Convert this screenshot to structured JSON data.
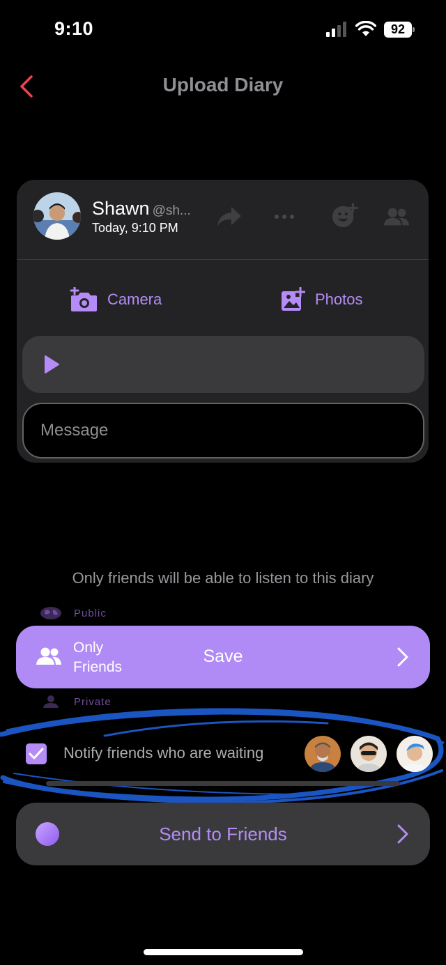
{
  "status_bar": {
    "time": "9:10",
    "battery": "92"
  },
  "header": {
    "title": "Upload Diary",
    "back_icon": "chevron-left-icon",
    "accent": "#e5484d"
  },
  "post": {
    "user_name": "Shawn",
    "user_handle": "@sh...",
    "time": "Today, 9:10 PM",
    "icons": [
      "share-icon",
      "more-icon",
      "add-emoji-icon",
      "friends-icon"
    ]
  },
  "media": {
    "camera_label": "Camera",
    "photos_label": "Photos"
  },
  "message": {
    "placeholder": "Message",
    "value": ""
  },
  "privacy": {
    "note": "Only friends will be able to listen to this diary",
    "option_public": "Public",
    "option_selected": "Only Friends",
    "option_private": "Private",
    "save_label": "Save"
  },
  "notify": {
    "label": "Notify friends who are waiting",
    "checked": true,
    "friend_count": 3
  },
  "send": {
    "label": "Send to Friends"
  },
  "colors": {
    "accent": "#b58cf7",
    "save_bar": "#b08bf6",
    "card": "#232325",
    "background": "#000000"
  }
}
